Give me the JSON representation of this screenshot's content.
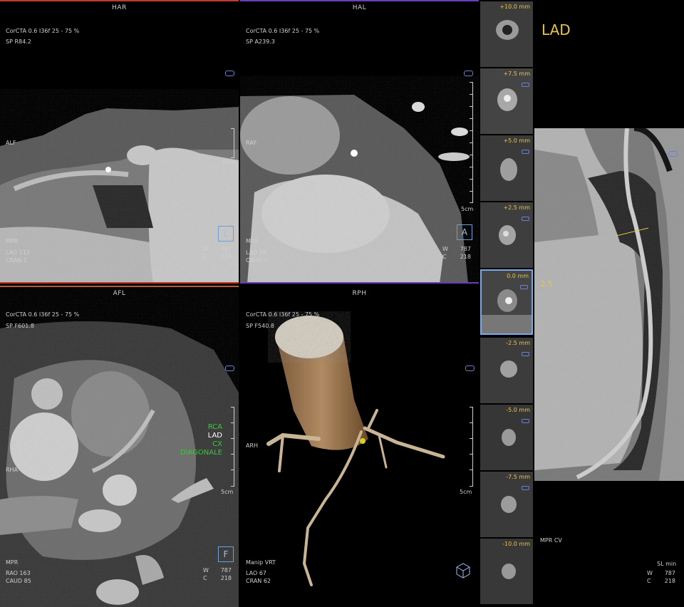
{
  "viewports": {
    "har": {
      "title": "HAR",
      "line1": "CorCTA  0.6  I36f  25 - 75 %",
      "line2": "SP R84.2",
      "orient": "ALF",
      "mode": "MPR",
      "ang1": "LAO 112",
      "ang2": "CRAN 1",
      "w_label": "W",
      "w_value": "787",
      "c_label": "C",
      "c_value": "218",
      "scale": "1cm",
      "cube": "L"
    },
    "hal": {
      "title": "HAL",
      "line1": "CorCTA  0.6  I36f  25 - 75 %",
      "line2": "SP A239.3",
      "orient": "RAF",
      "mode": "MPR",
      "ang1": "LAO 29",
      "ang2": "CAUD 5",
      "w_label": "W",
      "w_value": "787",
      "c_label": "C",
      "c_value": "218",
      "scale": "5cm",
      "cube": "A"
    },
    "afl": {
      "title": "AFL",
      "line1": "CorCTA  0.6  I36f  25 - 75 %",
      "line2": "SP F601.8",
      "orient": "RHA",
      "mode": "MPR",
      "ang1": "RAO 163",
      "ang2": "CAUD 85",
      "w_label": "W",
      "w_value": "787",
      "c_label": "C",
      "c_value": "218",
      "scale": "5cm",
      "cube": "F"
    },
    "rph": {
      "title": "RPH",
      "line1": "CorCTA  0.6  I36f  25 - 75 %",
      "line2": "SP F540.8",
      "orient": "ARH",
      "mode": "Manip VRT",
      "ang1": "LAO 67",
      "ang2": "CRAN 62",
      "scale": "5cm"
    },
    "cpr": {
      "vessel": "LAD",
      "marker": "2.5",
      "mode": "MPR CV",
      "sl": "SL min",
      "w_label": "W",
      "w_value": "787",
      "c_label": "C",
      "c_value": "218"
    }
  },
  "segments": [
    {
      "label": "RCA",
      "color": "#33cc33"
    },
    {
      "label": "LAD",
      "color": "#ffffff"
    },
    {
      "label": "CX",
      "color": "#33cc33"
    },
    {
      "label": "DIAGONALE",
      "color": "#33cc33"
    }
  ],
  "cross_sections": [
    "+10.0 mm",
    "+7.5 mm",
    "+5.0 mm",
    "+2.5 mm",
    "0.0 mm",
    "-2.5 mm",
    "-5.0 mm",
    "-7.5 mm",
    "-10.0 mm"
  ],
  "colors": {
    "har_bar": "#c0392b",
    "hal_bar": "#6a3cc0",
    "selected_frame": "#7aa8e8",
    "label_yellow": "#e8c34a"
  }
}
